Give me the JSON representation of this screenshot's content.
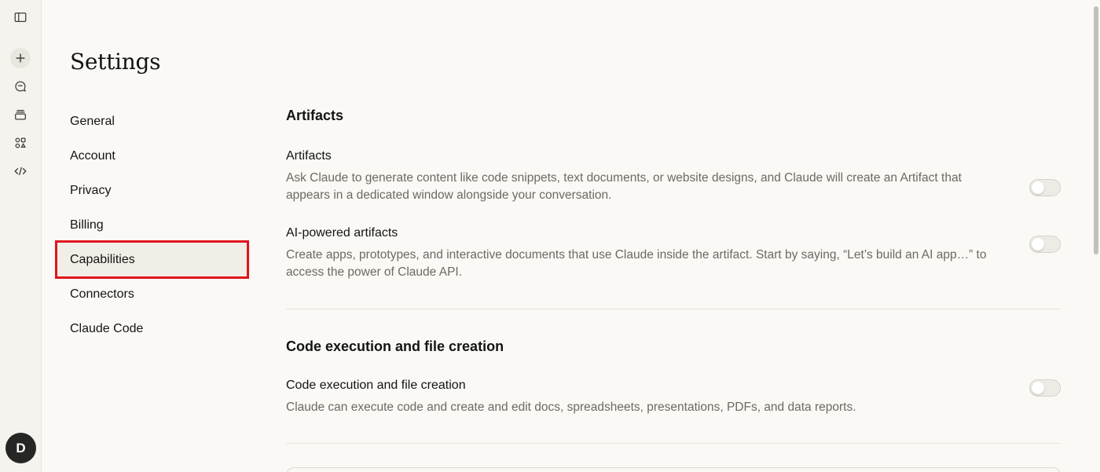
{
  "rail": {
    "icons": [
      "sidebar-toggle-icon",
      "plus-icon",
      "chat-bubble-icon",
      "projects-icon",
      "artifacts-icon",
      "code-icon"
    ],
    "avatar_initial": "D"
  },
  "settings": {
    "title": "Settings",
    "nav": [
      {
        "label": "General",
        "active": false
      },
      {
        "label": "Account",
        "active": false
      },
      {
        "label": "Privacy",
        "active": false
      },
      {
        "label": "Billing",
        "active": false
      },
      {
        "label": "Capabilities",
        "active": true
      },
      {
        "label": "Connectors",
        "active": false
      },
      {
        "label": "Claude Code",
        "active": false
      }
    ]
  },
  "sections": {
    "artifacts": {
      "title": "Artifacts",
      "rows": [
        {
          "label": "Artifacts",
          "description": "Ask Claude to generate content like code snippets, text documents, or website designs, and Claude will create an Artifact that appears in a dedicated window alongside your conversation.",
          "enabled": false
        },
        {
          "label": "AI-powered artifacts",
          "description": "Create apps, prototypes, and interactive documents that use Claude inside the artifact. Start by saying, “Let’s build an AI app…” to access the power of Claude API.",
          "enabled": false
        }
      ]
    },
    "code_execution": {
      "title": "Code execution and file creation",
      "rows": [
        {
          "label": "Code execution and file creation",
          "description": "Claude can execute code and create and edit docs, spreadsheets, presentations, PDFs, and data reports.",
          "enabled": false
        }
      ]
    }
  },
  "colors": {
    "background": "#faf9f5",
    "highlight_border": "#e0141e",
    "text_primary": "#141413",
    "text_secondary": "#6b6a65"
  }
}
